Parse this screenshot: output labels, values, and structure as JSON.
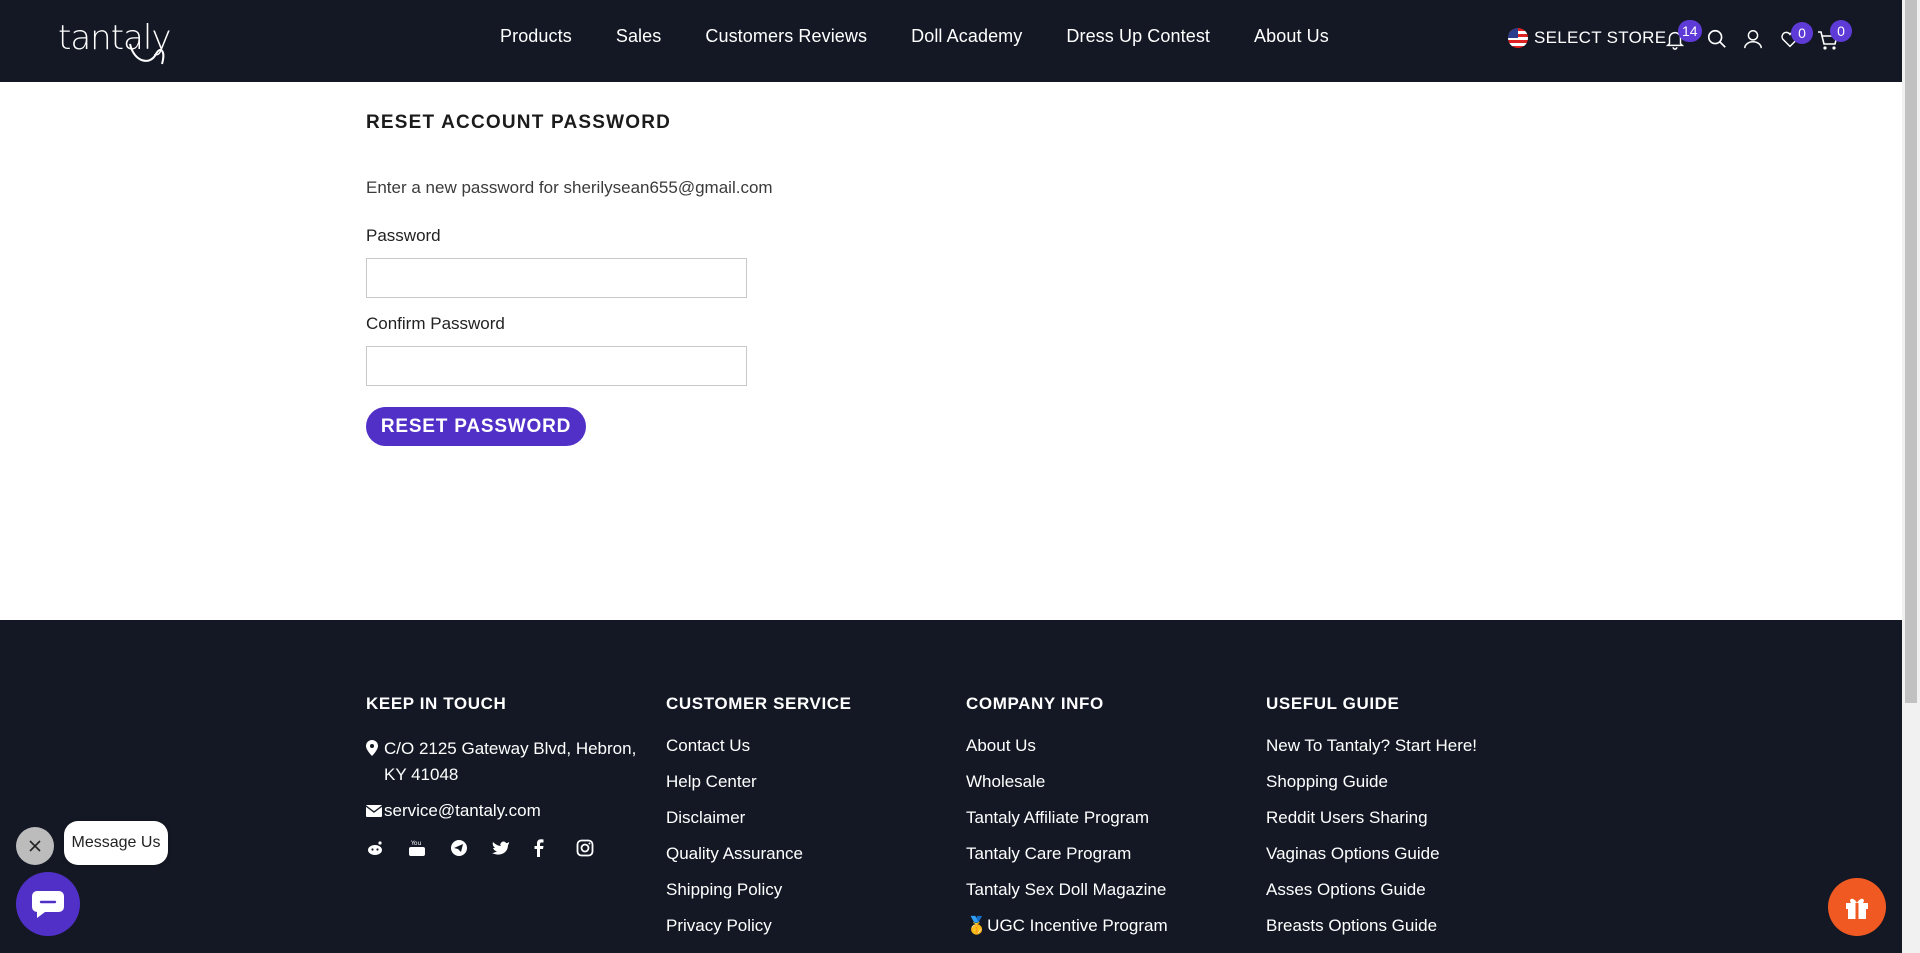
{
  "header": {
    "logo_text": "tantaly",
    "nav": [
      "Products",
      "Sales",
      "Customers Reviews",
      "Doll Academy",
      "Dress Up Contest",
      "About Us"
    ],
    "store_label": "SELECT STORE",
    "notifications_count": "14",
    "wishlist_count": "0",
    "cart_count": "0"
  },
  "main": {
    "title": "RESET ACCOUNT PASSWORD",
    "subtitle": "Enter a new password for sherilysean655@gmail.com",
    "password_label": "Password",
    "confirm_label": "Confirm Password",
    "password_value": "",
    "confirm_value": "",
    "reset_button": "RESET PASSWORD"
  },
  "footer": {
    "keep_in_touch": {
      "heading": "KEEP IN TOUCH",
      "address": "C/O 2125 Gateway Blvd, Hebron, KY 41048",
      "email": "service@tantaly.com",
      "socials": [
        "reddit-icon",
        "youtube-icon",
        "telegram-icon",
        "twitter-icon",
        "facebook-icon",
        "instagram-icon"
      ]
    },
    "customer_service": {
      "heading": "CUSTOMER SERVICE",
      "links": [
        "Contact Us",
        "Help Center",
        "Disclaimer",
        "Quality Assurance",
        "Shipping Policy",
        "Privacy Policy"
      ]
    },
    "company_info": {
      "heading": "COMPANY INFO",
      "links": [
        "About Us",
        "Wholesale",
        "Tantaly Affiliate Program",
        "Tantaly Care Program",
        "Tantaly Sex Doll Magazine",
        "🥇UGC Incentive Program"
      ]
    },
    "useful_guide": {
      "heading": "USEFUL GUIDE",
      "links": [
        "New To Tantaly? Start Here!",
        "Shopping Guide",
        "Reddit Users Sharing",
        "Vaginas Options Guide",
        "Asses Options Guide",
        "Breasts Options Guide"
      ]
    }
  },
  "widgets": {
    "message_us": "Message Us"
  },
  "colors": {
    "header_bg": "#131824",
    "accent": "#5130c8",
    "gift": "#f05a22"
  }
}
